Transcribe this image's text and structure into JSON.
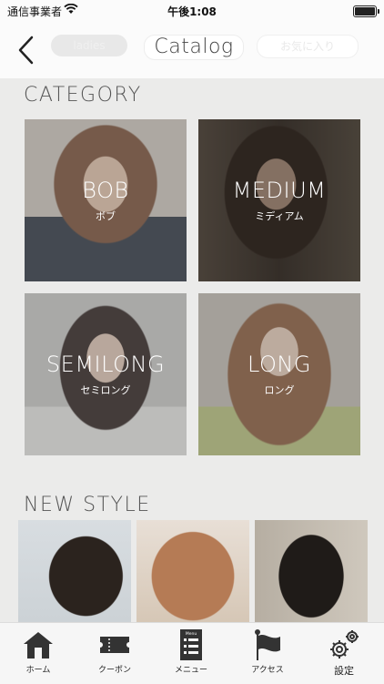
{
  "status_bar": {
    "carrier": "通信事業者",
    "time": "午後1:08"
  },
  "nav": {
    "title": "Catalog",
    "left_pill": "ladies",
    "right_pill": "お気に入り"
  },
  "category": {
    "title": "CATEGORY",
    "items": [
      {
        "en": "BOB",
        "jp": "ボブ"
      },
      {
        "en": "MEDIUM",
        "jp": "ミディアム"
      },
      {
        "en": "SEMILONG",
        "jp": "セミロング"
      },
      {
        "en": "LONG",
        "jp": "ロング"
      }
    ]
  },
  "new_style": {
    "title": "NEW STYLE"
  },
  "tabbar": {
    "items": [
      {
        "label": "ホーム",
        "icon": "home-icon"
      },
      {
        "label": "クーポン",
        "icon": "coupon-icon"
      },
      {
        "label": "メニュー",
        "icon": "menu-icon",
        "icon_text": "Menu"
      },
      {
        "label": "アクセス",
        "icon": "flag-icon"
      },
      {
        "label": "設定",
        "icon": "gear-icon"
      }
    ]
  }
}
